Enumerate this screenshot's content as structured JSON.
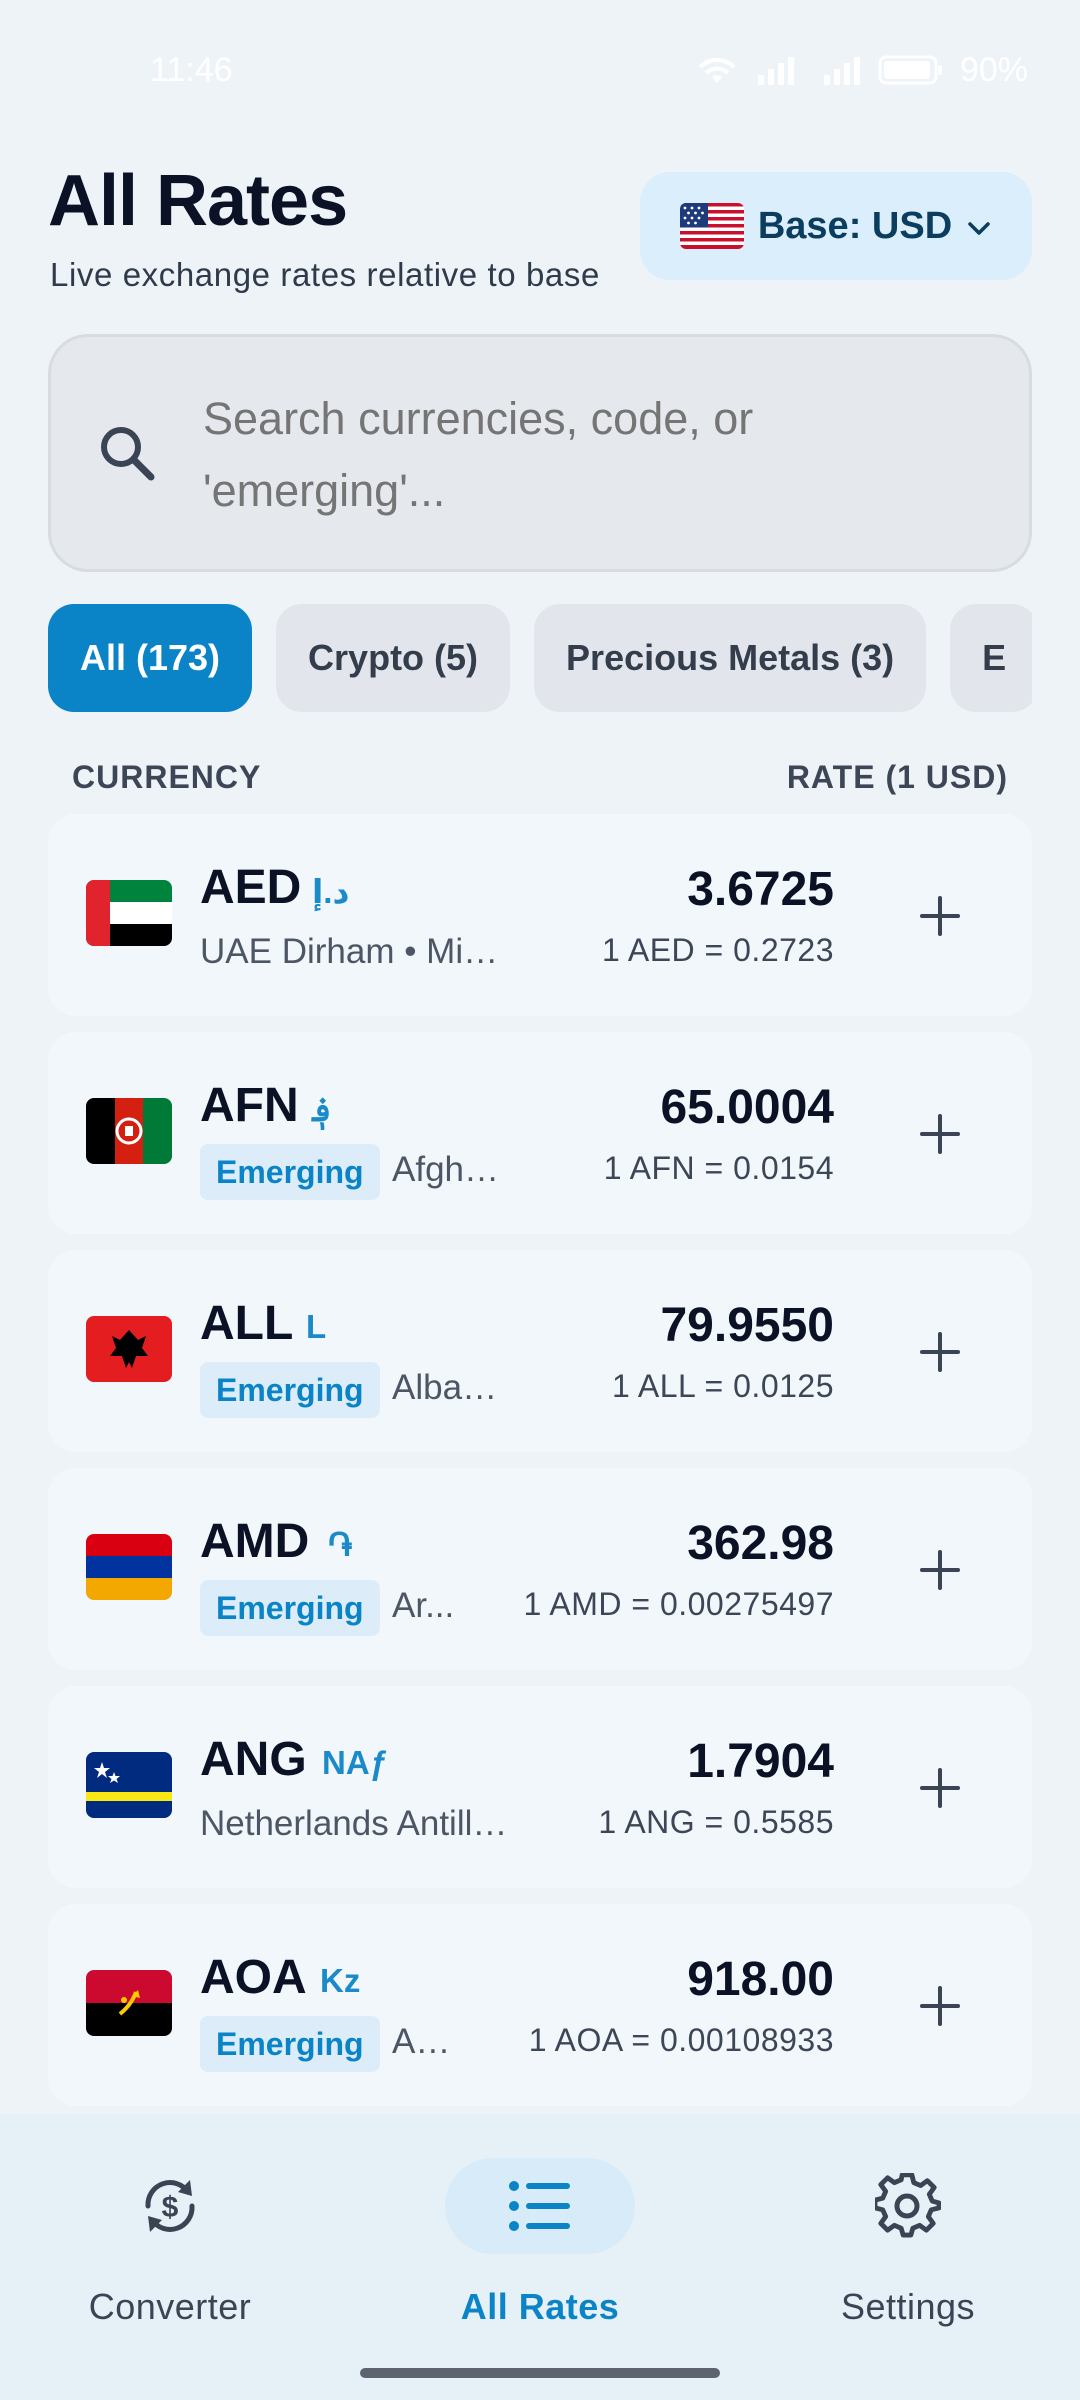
{
  "status_bar": {
    "time": "11:46",
    "battery": "90%"
  },
  "header": {
    "title": "All Rates",
    "subtitle": "Live exchange rates relative to base",
    "base_label": "Base: USD",
    "base_flag_icon": "us-flag-icon"
  },
  "search": {
    "placeholder": "Search currencies, code, or 'emerging'..."
  },
  "chips": [
    {
      "label": "All (173)",
      "active": true
    },
    {
      "label": "Crypto (5)",
      "active": false
    },
    {
      "label": "Precious Metals (3)",
      "active": false
    },
    {
      "label": "E",
      "active": false
    }
  ],
  "columns": {
    "currency": "CURRENCY",
    "rate": "RATE (1 USD)"
  },
  "rates": [
    {
      "code": "AED",
      "symbol": "د.إ",
      "badge": "",
      "name": "UAE Dirham • Middl...",
      "rate": "3.6725",
      "inverse": "1 AED = 0.2723",
      "flag": "uae-flag-icon"
    },
    {
      "code": "AFN",
      "symbol": "؋",
      "badge": "Emerging",
      "name": "Afghan ...",
      "rate": "65.0004",
      "inverse": "1 AFN = 0.0154",
      "flag": "afghanistan-flag-icon"
    },
    {
      "code": "ALL",
      "symbol": "L",
      "badge": "Emerging",
      "name": "Albanian...",
      "rate": "79.9550",
      "inverse": "1 ALL = 0.0125",
      "flag": "albania-flag-icon"
    },
    {
      "code": "AMD",
      "symbol": "֏",
      "badge": "Emerging",
      "name": "Ar...",
      "rate": "362.98",
      "inverse": "1 AMD = 0.00275497",
      "flag": "armenia-flag-icon"
    },
    {
      "code": "ANG",
      "symbol": "NAƒ",
      "badge": "",
      "name": "Netherlands Antille...",
      "rate": "1.7904",
      "inverse": "1 ANG = 0.5585",
      "flag": "curacao-flag-icon"
    },
    {
      "code": "AOA",
      "symbol": "Kz",
      "badge": "Emerging",
      "name": "An...",
      "rate": "918.00",
      "inverse": "1 AOA = 0.00108933",
      "flag": "angola-flag-icon"
    }
  ],
  "nav": [
    {
      "label": "Converter",
      "icon": "currency-exchange-icon",
      "active": false
    },
    {
      "label": "All Rates",
      "icon": "list-icon",
      "active": true
    },
    {
      "label": "Settings",
      "icon": "gear-icon",
      "active": false
    }
  ],
  "colors": {
    "accent": "#0a84c6",
    "background": "#eef3f8",
    "card": "#f2f7fb"
  }
}
